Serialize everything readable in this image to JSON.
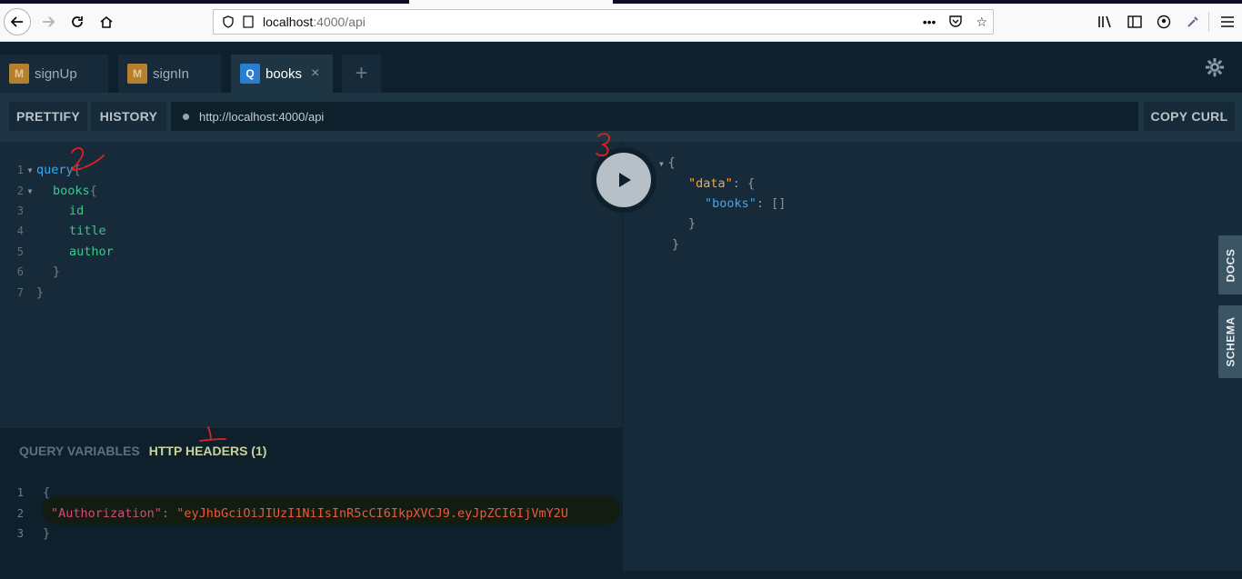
{
  "browser": {
    "url_host": "localhost",
    "url_path": ":4000/api"
  },
  "tabs": [
    {
      "badge": "M",
      "label": "signUp"
    },
    {
      "badge": "M",
      "label": "signIn"
    },
    {
      "badge": "Q",
      "label": "books",
      "close": "×"
    }
  ],
  "add_tab": "+",
  "toolbar": {
    "prettify": "PRETTIFY",
    "history": "HISTORY",
    "endpoint": "http://localhost:4000/api",
    "copy_curl": "COPY CURL"
  },
  "query": {
    "lines": [
      {
        "n": "1",
        "text": "query",
        "suffix": " {"
      },
      {
        "n": "2",
        "text": "books",
        "suffix": " {"
      },
      {
        "n": "3",
        "text": "id"
      },
      {
        "n": "4",
        "text": "title"
      },
      {
        "n": "5",
        "text": "author"
      },
      {
        "n": "6",
        "text": "}"
      },
      {
        "n": "7",
        "text": "}"
      }
    ]
  },
  "result": {
    "open_brace": "{",
    "data_key": "\"data\"",
    "books_key": "\"books\"",
    "books_value": "[]",
    "inner_close": "}",
    "outer_close": "}"
  },
  "side_tabs": {
    "docs": "DOCS",
    "schema": "SCHEMA"
  },
  "variables": {
    "query_variables_tab": "QUERY VARIABLES",
    "http_headers_tab": "HTTP HEADERS (1)",
    "lines": [
      {
        "n": "1",
        "text": "{"
      },
      {
        "n": "2",
        "key": "\"Authorization\"",
        "value": "\"eyJhbGciOiJIUzI1NiIsInR5cCI6IkpXVCJ9.eyJpZCI6IjVmY2U"
      },
      {
        "n": "3",
        "text": "}"
      }
    ]
  },
  "annotations": {
    "mark_1": "1",
    "mark_2": "2",
    "mark_3": "3"
  },
  "colors": {
    "keyword": "#3aa8f2",
    "field": "#3bc68a",
    "json_key": "#f5a742",
    "header_key": "#d14c7d",
    "header_value": "#e85a3a"
  }
}
